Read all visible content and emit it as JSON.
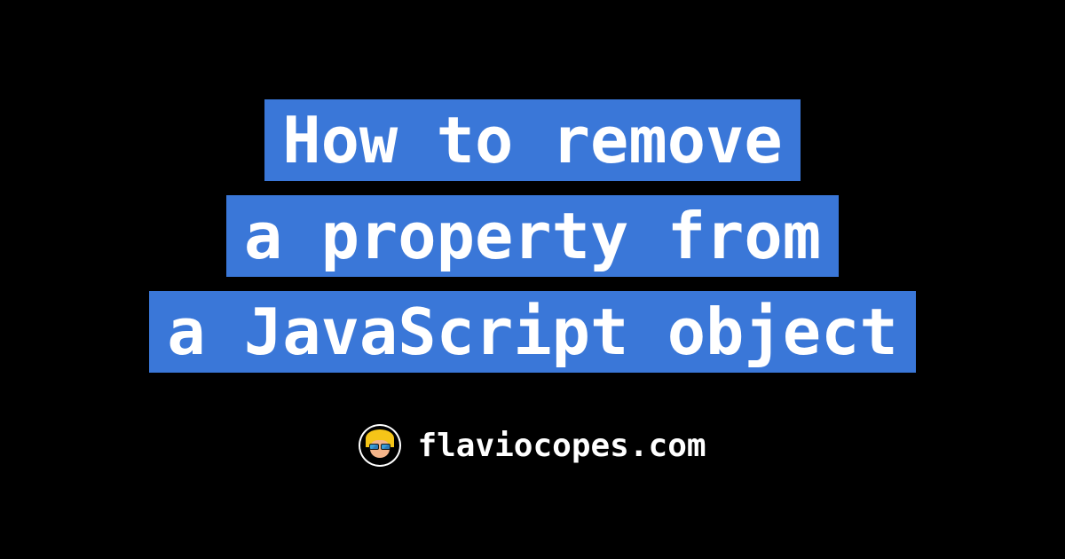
{
  "title": {
    "lines": [
      "How to remove",
      "a property from",
      "a JavaScript object"
    ]
  },
  "footer": {
    "site_name": "flaviocopes.com"
  },
  "colors": {
    "background": "#000000",
    "highlight": "#3a77d8",
    "text": "#ffffff"
  }
}
